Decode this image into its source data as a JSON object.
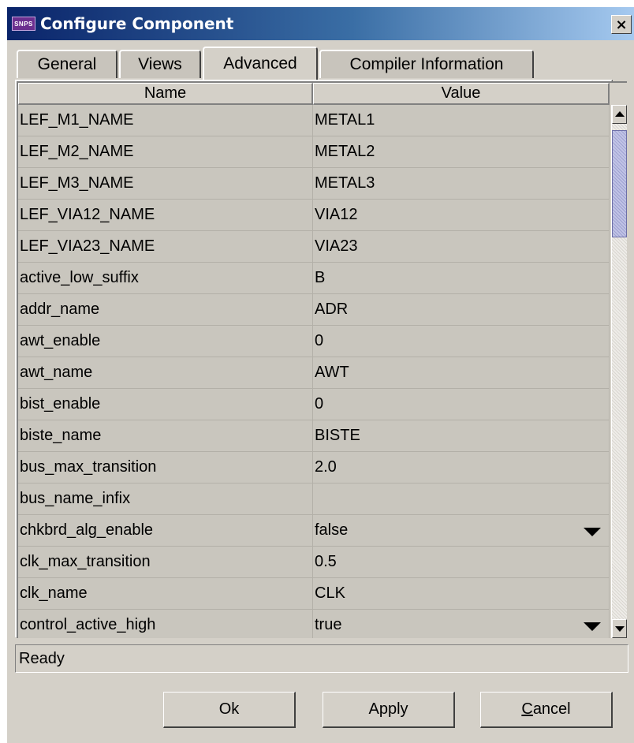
{
  "window": {
    "title": "Configure Component",
    "app_icon_text": "SNPS",
    "close_glyph": "×"
  },
  "tabs": [
    {
      "label": "General",
      "active": false
    },
    {
      "label": "Views",
      "active": false
    },
    {
      "label": "Advanced",
      "active": true
    },
    {
      "label": "Compiler Information",
      "active": false
    }
  ],
  "table": {
    "headers": [
      "Name",
      "Value"
    ],
    "rows": [
      {
        "name": "LEF_M1_NAME",
        "value": "METAL1"
      },
      {
        "name": "LEF_M2_NAME",
        "value": "METAL2"
      },
      {
        "name": "LEF_M3_NAME",
        "value": "METAL3"
      },
      {
        "name": "LEF_VIA12_NAME",
        "value": "VIA12"
      },
      {
        "name": "LEF_VIA23_NAME",
        "value": "VIA23"
      },
      {
        "name": "active_low_suffix",
        "value": "B"
      },
      {
        "name": "addr_name",
        "value": "ADR"
      },
      {
        "name": "awt_enable",
        "value": "0"
      },
      {
        "name": "awt_name",
        "value": "AWT"
      },
      {
        "name": "bist_enable",
        "value": "0"
      },
      {
        "name": "biste_name",
        "value": "BISTE"
      },
      {
        "name": "bus_max_transition",
        "value": "2.0"
      },
      {
        "name": "bus_name_infix",
        "value": ""
      },
      {
        "name": "chkbrd_alg_enable",
        "value": "false",
        "dropdown": true
      },
      {
        "name": "clk_max_transition",
        "value": "0.5"
      },
      {
        "name": "clk_name",
        "value": "CLK"
      },
      {
        "name": "control_active_high",
        "value": "true",
        "dropdown": true
      }
    ]
  },
  "status": {
    "text": "Ready"
  },
  "buttons": {
    "ok": "Ok",
    "apply": "Apply",
    "cancel_mnemonic": "C",
    "cancel_rest": "ancel"
  }
}
